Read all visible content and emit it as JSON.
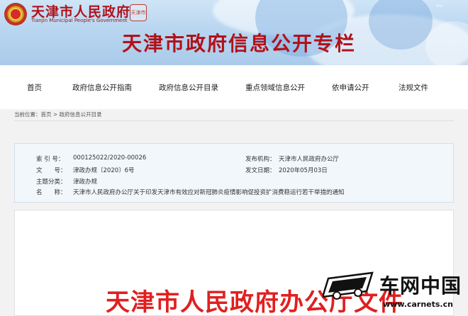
{
  "header": {
    "site_title": "天津市人民政府",
    "site_subtitle": "Tianjin Municipal People's Government",
    "seal_text": "天津市",
    "banner_title": "天津市政府信息公开专栏"
  },
  "nav": {
    "items": [
      "首页",
      "政府信息公开指南",
      "政府信息公开目录",
      "重点领域信息公开",
      "依申请公开",
      "法规文件"
    ]
  },
  "breadcrumb": {
    "prefix": "当前位置：",
    "path": "首页 > 政府信息公开目录"
  },
  "meta": {
    "index_label": "索 引 号：",
    "index_value": "000125022/2020-00026",
    "publisher_label": "发布机构：",
    "publisher_value": "天津市人民政府办公厅",
    "docno_label": "文　　号：",
    "docno_value": "津政办规〔2020〕6号",
    "date_label": "发文日期：",
    "date_value": "2020年05月03日",
    "topic_label": "主题分类：",
    "topic_value": "津政办规",
    "name_label": "名　　称：",
    "name_value": "天津市人民政府办公厅关于印发天津市有效应对新冠肺炎疫情影响促投资扩消费稳运行若干举措的通知"
  },
  "document": {
    "heading": "天津市人民政府办公厅文件"
  },
  "watermark": {
    "brand": "车网中国",
    "url": "www.carnets.cn"
  },
  "colors": {
    "brand_red": "#b0121b",
    "doc_red": "#e02020",
    "header_blue": "#b9d6f0",
    "meta_bg": "#f2f7fc"
  }
}
